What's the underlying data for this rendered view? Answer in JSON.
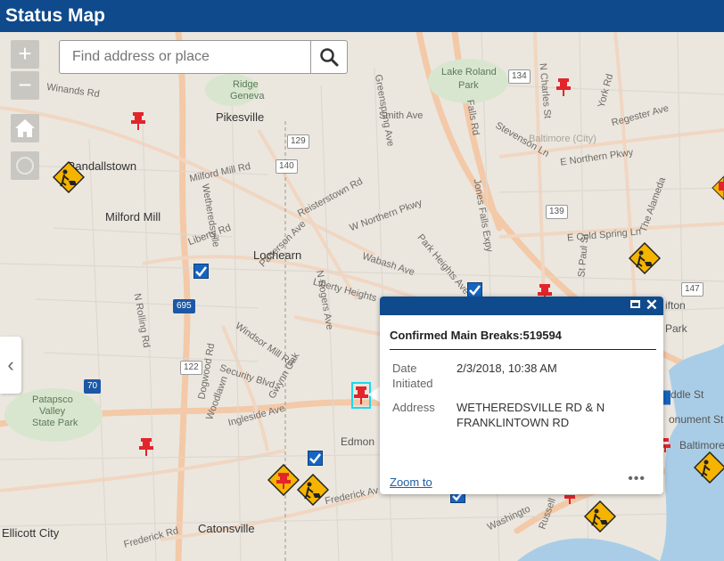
{
  "header": {
    "title": "Status Map"
  },
  "controls": {
    "zoom_in": "+",
    "zoom_out": "−",
    "collapse_glyph": "‹"
  },
  "search": {
    "placeholder": "Find address or place"
  },
  "map": {
    "places": {
      "pikesville": "Pikesville",
      "randallstown": "Randallstown",
      "milford_mill": "Milford Mill",
      "lochearn": "Lochearn",
      "lake_roland_1": "Lake Roland",
      "lake_roland_2": "Park",
      "patapsco_1": "Patapsco",
      "patapsco_2": "Valley",
      "patapsco_3": "State Park",
      "ellicott_city": "Ellicott City",
      "catonsville": "Catonsville",
      "baltimore": "Baltimore (City)",
      "rgeg_1": "Ridge",
      "rgeg_2": "Geneva"
    },
    "roads": {
      "winands": "Winands Rd",
      "smith": "Smith Ave",
      "milford_mill_rd": "Milford Mill Rd",
      "reisterstown": "Reisterstown Rd",
      "northern_pkwy": "W Northern Pkwy",
      "patterson": "Patterson Ave",
      "liberty": "Liberty Rd",
      "liberty_heights": "Liberty Heights",
      "wabash": "Wabash Ave",
      "park_heights": "Park Heights Ave",
      "rolling": "N Rolling Rd",
      "windsor_mill": "Windsor Mill Rd",
      "security": "Security Blvd",
      "ingleside": "Ingleside Ave",
      "edmondson": "Edmon",
      "frederick1": "Frederick Rd",
      "frederick2": "Frederick Av",
      "regester": "Regester Ave",
      "e_northern": "E Northern Pkwy",
      "e_cold_spring": "E Cold Spring Ln",
      "the_alameda": "The Alameda",
      "charles": "N Charles St",
      "york": "York Rd",
      "falls": "Falls Rd",
      "jones_falls": "Jones Falls Expy",
      "greenspring": "Greenspring Ave",
      "middle_st": "ddle St",
      "monument": "onument St",
      "baltimore_r": "Baltimore",
      "clifton": "ifton",
      "park_r": "Park",
      "washington": "Washingto",
      "russell": "Russell",
      "wetheredsville": "Wetheredsville",
      "n_rogers": "N Rogers Ave",
      "stevenson": "Stevenson Ln",
      "woodlawn": "Woodlawn",
      "n_paul": "St Paul St",
      "dogwood": "Dogwood Rd",
      "gwynn": "Gwynn Oak"
    },
    "shields": {
      "s129": "129",
      "s140": "140",
      "s134": "134",
      "s139": "139",
      "s147": "147",
      "s122": "122",
      "s70": "70",
      "s695": "695"
    }
  },
  "popup": {
    "title": "Confirmed Main Breaks:519594",
    "fields": [
      {
        "label": "Date Initiated",
        "value": "2/3/2018, 10:38 AM"
      },
      {
        "label": "Address",
        "value": "WETHEREDSVILLE RD & N FRANKLINTOWN RD"
      }
    ],
    "zoom_to": "Zoom to",
    "more": "•••"
  },
  "colors": {
    "header": "#0f4a8c",
    "pin": "#e3242b",
    "check": "#1565c0",
    "work": "#f4b400"
  }
}
